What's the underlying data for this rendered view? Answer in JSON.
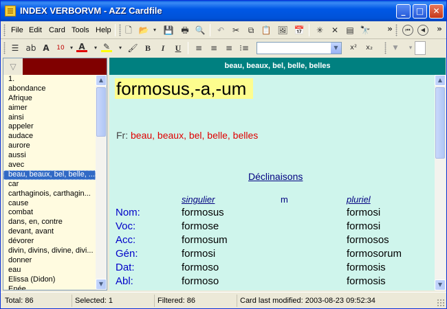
{
  "window": {
    "title": "INDEX VERBORVM - AZZ Cardfile",
    "buttons": {
      "minimize": "_",
      "maximize": "□",
      "close": "✕"
    }
  },
  "menu": [
    {
      "label": "File",
      "mnemonic": "F"
    },
    {
      "label": "Edit",
      "mnemonic": "E"
    },
    {
      "label": "Card",
      "mnemonic": "C"
    },
    {
      "label": "Tools",
      "mnemonic": "T"
    },
    {
      "label": "Help",
      "mnemonic": "H"
    }
  ],
  "toolbar1_icons": [
    "new-card-icon",
    "open-icon",
    "save-icon",
    "print-icon",
    "print-preview-icon",
    "undo-icon",
    "cut-icon",
    "copy-icon",
    "paste-icon",
    "insert-picture-icon",
    "insert-datetime-icon",
    "new-entry-icon",
    "delete-icon",
    "properties-icon",
    "find-icon",
    "first-card-icon",
    "previous-card-icon"
  ],
  "toolbar2": {
    "font_size": "10",
    "font_name": "",
    "bold": "B",
    "italic": "I",
    "underline": "U",
    "superscript": "x²",
    "subscript": "x₂",
    "font_color": "#e00000",
    "highlight_color": "#ffff00"
  },
  "sidebar": {
    "filter_color": "#800000",
    "words": [
      "1.",
      "abondance",
      "Afrique",
      "aimer",
      "ainsi",
      "appeler",
      "audace",
      "aurore",
      "aussi",
      "avec",
      "beau, beaux, bel, belle, ...",
      "car",
      "carthaginois, carthagin...",
      "cause",
      "combat",
      "dans, en, contre",
      "devant, avant",
      "dévorer",
      "divin, divins, divine, divi...",
      "donner",
      "eau",
      "Elissa (Didon)",
      "Enée"
    ],
    "selected_index": 10
  },
  "card": {
    "header": "beau, beaux, bel, belle, belles",
    "headword": "formosus,-a,-um",
    "fr_label": "Fr:",
    "fr_text": "beau, beaux, bel, belle, belles",
    "declension_title": "Déclinaisons",
    "col_singular": "singulier",
    "col_gender": "m",
    "col_plural": "pluriel",
    "cases": [
      {
        "case": "Nom:",
        "singular": "formosus",
        "plural": "formosi"
      },
      {
        "case": "Voc:",
        "singular": "formose",
        "plural": "formosi"
      },
      {
        "case": "Acc:",
        "singular": "formosum",
        "plural": "formosos"
      },
      {
        "case": "Gén:",
        "singular": "formosi",
        "plural": "formosorum"
      },
      {
        "case": "Dat:",
        "singular": "formoso",
        "plural": "formosis"
      },
      {
        "case": "Abl:",
        "singular": "formoso",
        "plural": "formosis"
      }
    ]
  },
  "status": {
    "total": "Total: 86",
    "selected": "Selected: 1",
    "filtered": "Filtered: 86",
    "modified": "Card last modified: 2003-08-23  09:52:34"
  }
}
